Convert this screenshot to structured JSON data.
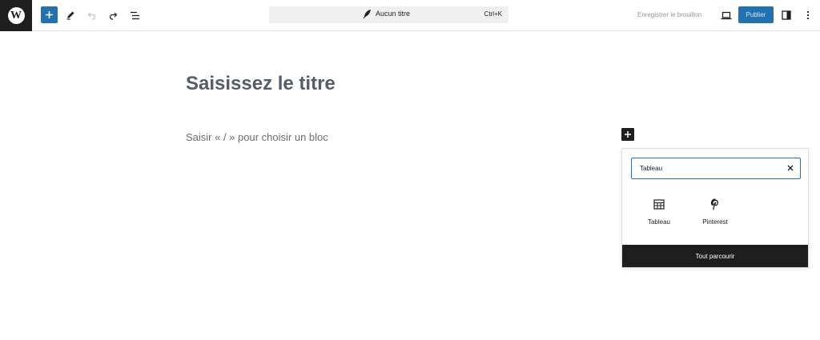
{
  "topbar": {
    "logo": "W",
    "add_icon": "plus-icon",
    "tools_icon": "pen-icon",
    "undo_icon": "undo-icon",
    "redo_icon": "redo-icon",
    "outline_icon": "list-view-icon",
    "document": {
      "icon": "feather-icon",
      "title": "Aucun titre",
      "shortcut": "Ctrl+K"
    },
    "save_draft_label": "Enregistrer le brouillon",
    "preview_icon": "laptop-icon",
    "publish_label": "Publier",
    "settings_icon": "sidebar-toggle-icon",
    "options_icon": "vertical-ellipsis-icon"
  },
  "editor": {
    "title_placeholder": "Saisissez le titre",
    "block_placeholder": "Saisir « / » pour choisir un bloc",
    "inline_add_icon": "plus-icon"
  },
  "inserter": {
    "search_value": "Tableau",
    "clear_icon": "close-icon",
    "results": [
      {
        "label": "Tableau",
        "icon": "table-icon"
      },
      {
        "label": "Pinterest",
        "icon": "pinterest-icon"
      }
    ],
    "browse_all_label": "Tout parcourir"
  },
  "colors": {
    "accent": "#2271b1",
    "dark": "#1e1e1e",
    "doc_bar_bg": "#f0f0f0",
    "muted_text": "#949494"
  }
}
